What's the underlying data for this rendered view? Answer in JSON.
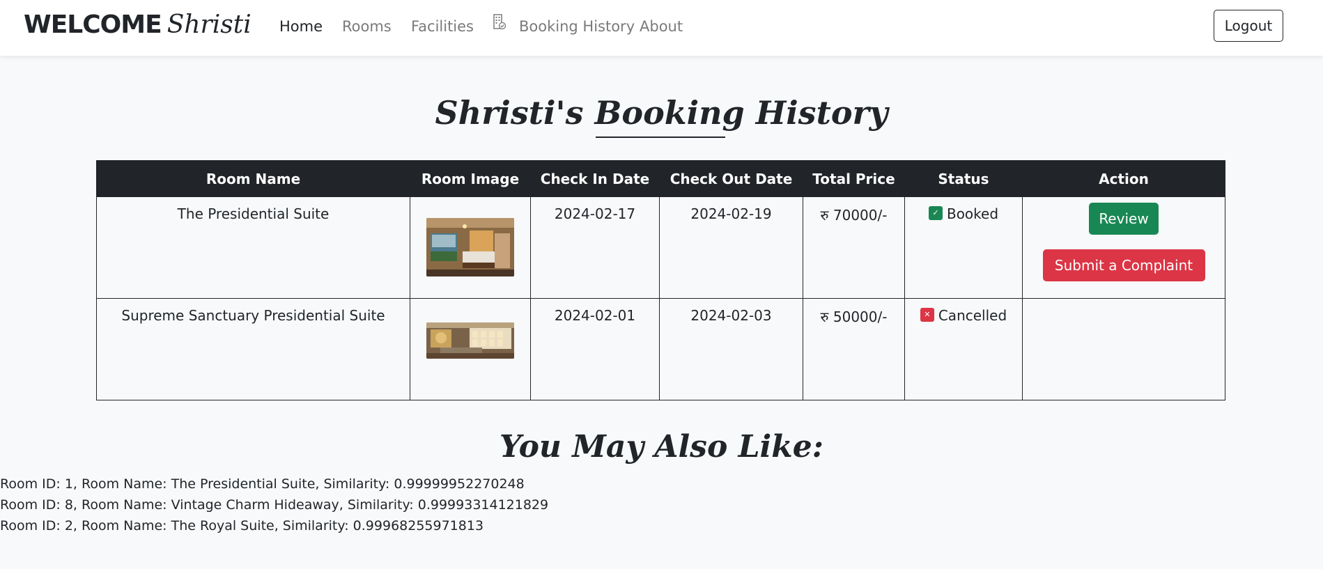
{
  "nav": {
    "brand_welcome": "WELCOME",
    "brand_name": "Shristi",
    "links": [
      "Home",
      "Rooms",
      "Facilities",
      "Booking History",
      "About"
    ],
    "logout_label": "Logout"
  },
  "page": {
    "title": "Shristi's Booking History"
  },
  "table": {
    "headers": [
      "Room Name",
      "Room Image",
      "Check In Date",
      "Check Out Date",
      "Total Price",
      "Status",
      "Action"
    ],
    "rows": [
      {
        "room_name": "The Presidential Suite",
        "check_in": "2024-02-17",
        "check_out": "2024-02-19",
        "total_price": "रु 70000/-",
        "status": "Booked",
        "status_icon": "calendar-check-icon",
        "actions": [
          "Review",
          "Submit a Complaint"
        ]
      },
      {
        "room_name": "Supreme Sanctuary Presidential Suite",
        "check_in": "2024-02-01",
        "check_out": "2024-02-03",
        "total_price": "रु 50000/-",
        "status": "Cancelled",
        "status_icon": "calendar-x-icon",
        "actions": []
      }
    ]
  },
  "recommendations": {
    "heading": "You May Also Like:",
    "items": [
      "Room ID: 1, Room Name: The Presidential Suite, Similarity: 0.99999952270248",
      "Room ID: 8, Room Name: Vintage Charm Hideaway, Similarity: 0.99993314121829",
      "Room ID: 2, Room Name: The Royal Suite, Similarity: 0.99968255971813"
    ]
  },
  "colors": {
    "navbar_bg": "#ffffff",
    "page_bg": "#f8f9fa",
    "table_header_bg": "#212529",
    "success": "#198754",
    "danger": "#dc3545"
  }
}
